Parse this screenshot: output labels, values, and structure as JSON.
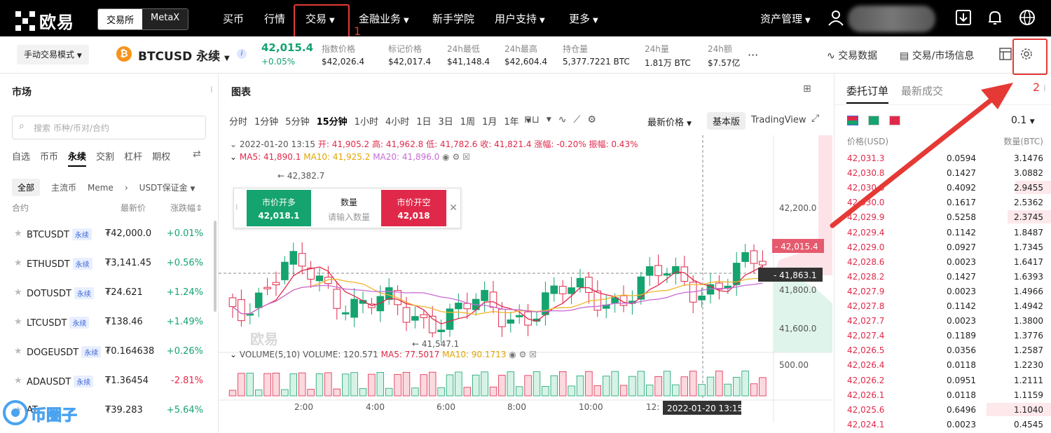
{
  "topbar": {
    "logo_text": "欧易",
    "segment": [
      "交易所",
      "MetaX"
    ],
    "nav": [
      {
        "label": "买币",
        "chev": false
      },
      {
        "label": "行情",
        "chev": false
      },
      {
        "label": "交易",
        "chev": true
      },
      {
        "label": "金融业务",
        "chev": true
      },
      {
        "label": "新手学院",
        "chev": false
      },
      {
        "label": "用户支持",
        "chev": true
      },
      {
        "label": "更多",
        "chev": true
      }
    ],
    "asset_mgmt": "资产管理",
    "annotation_1": "1",
    "icons": [
      "download-icon",
      "bell-icon",
      "globe-icon"
    ]
  },
  "ticker": {
    "mode": "手动交易模式",
    "symbol": "BTCUSD 永续",
    "coin": "₿",
    "last": "42,015.4",
    "change": "+0.05%",
    "stats": [
      {
        "k": "指数价格",
        "v": "$42,026.4"
      },
      {
        "k": "标记价格",
        "v": "$42,017.4"
      },
      {
        "k": "24h最低",
        "v": "$41,148.4"
      },
      {
        "k": "24h最高",
        "v": "$42,604.4"
      },
      {
        "k": "持仓量",
        "v": "5,377.7221 BTC"
      },
      {
        "k": "24h量",
        "v": "1.81万 BTC"
      },
      {
        "k": "24h额",
        "v": "$7.57亿"
      }
    ],
    "more": "···",
    "trade_data": "交易数据",
    "market_info": "交易/市场信息",
    "annotation_2": "2"
  },
  "market": {
    "title": "市场",
    "search_placeholder": "搜索 币种/币对/合约",
    "tabs": [
      "自选",
      "币币",
      "永续",
      "交割",
      "杠杆",
      "期权"
    ],
    "active_tab": "永续",
    "subtabs": [
      "全部",
      "主流币",
      "Meme",
      "USDT保证金"
    ],
    "col_contract": "合约",
    "col_price": "最新价",
    "col_change": "涨跌幅",
    "badge": "永续",
    "rows": [
      {
        "name": "BTCUSDT",
        "price": "₮42,000.0",
        "change": "+0.01%",
        "dir": "up"
      },
      {
        "name": "ETHUSDT",
        "price": "₮3,141.45",
        "change": "+0.56%",
        "dir": "up"
      },
      {
        "name": "DOTUSDT",
        "price": "₮24.621",
        "change": "+1.24%",
        "dir": "up"
      },
      {
        "name": "LTCUSDT",
        "price": "₮138.46",
        "change": "+1.49%",
        "dir": "up"
      },
      {
        "name": "DOGEUSDT",
        "price": "₮0.164638",
        "change": "+0.26%",
        "dir": "up"
      },
      {
        "name": "ADAUSDT",
        "price": "₮1.36454",
        "change": "-2.81%",
        "dir": "dn"
      },
      {
        "name": "AT",
        "price": "₮39.283",
        "change": "+5.64%",
        "dir": "up"
      }
    ],
    "watermark": "币圈子"
  },
  "chart": {
    "title": "图表",
    "intervals": [
      "分时",
      "1分钟",
      "5分钟",
      "15分钟",
      "1小时",
      "4小时",
      "1日",
      "3日",
      "1周",
      "1月",
      "1年"
    ],
    "active_interval": "15分钟",
    "price_type": "最新价格",
    "basic": "基本版",
    "tv": "TradingView",
    "ohlc": {
      "date": "2022-01-20 13:15",
      "open": "开: 41,905.2",
      "high": "高: 41,962.8",
      "low": "低: 41,782.6",
      "close": "收: 41,821.4",
      "chg": "涨幅: -0.20%",
      "amp": "振幅: 0.43%"
    },
    "ma": {
      "ma5": "MA5: 41,890.1",
      "ma10": "MA10: 41,925.2",
      "ma20": "MA20: 41,896.0"
    },
    "vol": {
      "label": "VOLUME(5,10)",
      "v": "VOLUME: 120.571",
      "ma5": "MA5: 77.5017",
      "ma10": "MA10: 90.1713"
    },
    "hi_label": "← 42,382.7",
    "lo_label": "← 41,547.1",
    "axis": [
      "42,200.0",
      "41,800.0",
      "41,600.0",
      "500.00"
    ],
    "last_tag": "- 42,015.4",
    "cross_tag": "- 41,863.1",
    "time_axis": [
      "2:00",
      "4:00",
      "6:00",
      "8:00",
      "10:00",
      "12:"
    ],
    "cross_time": "2022-01-20 13:15",
    "watermark": "欧易",
    "popup": {
      "buy": "市价开多",
      "buy_price": "42,018.1",
      "qty": "数量",
      "qty_ph": "请输入数量",
      "sell": "市价开空",
      "sell_price": "42,018"
    },
    "colors": {
      "up": "#15a36f",
      "down": "#e0294a",
      "ma5": "#e0294a",
      "ma10": "#f0b429",
      "ma20": "#c86ad4"
    }
  },
  "orderbook": {
    "tab1": "委托订单",
    "tab2": "最新成交",
    "step": "0.1",
    "col_price": "价格(USD)",
    "col_qty": "数量(BTC)",
    "rows": [
      {
        "p": "42,031.3",
        "q": "0.0594",
        "t": "3.1476",
        "d": 0.0
      },
      {
        "p": "42,030.8",
        "q": "0.1427",
        "t": "3.0882",
        "d": 0.0
      },
      {
        "p": "42,030.3",
        "q": "0.4092",
        "t": "2.9455",
        "d": 0.35
      },
      {
        "p": "42,030.0",
        "q": "0.1617",
        "t": "2.5362",
        "d": 0.0
      },
      {
        "p": "42,029.9",
        "q": "0.5258",
        "t": "2.3745",
        "d": 0.42
      },
      {
        "p": "42,029.4",
        "q": "0.1142",
        "t": "1.8487",
        "d": 0.0
      },
      {
        "p": "42,029.0",
        "q": "0.0927",
        "t": "1.7345",
        "d": 0.0
      },
      {
        "p": "42,028.6",
        "q": "0.0023",
        "t": "1.6417",
        "d": 0.0
      },
      {
        "p": "42,028.2",
        "q": "0.1427",
        "t": "1.6393",
        "d": 0.0
      },
      {
        "p": "42,027.9",
        "q": "0.0023",
        "t": "1.4966",
        "d": 0.0
      },
      {
        "p": "42,027.8",
        "q": "0.1142",
        "t": "1.4942",
        "d": 0.0
      },
      {
        "p": "42,027.7",
        "q": "0.0023",
        "t": "1.3800",
        "d": 0.0
      },
      {
        "p": "42,027.4",
        "q": "0.1189",
        "t": "1.3776",
        "d": 0.0
      },
      {
        "p": "42,026.5",
        "q": "0.0356",
        "t": "1.2587",
        "d": 0.0
      },
      {
        "p": "42,026.4",
        "q": "0.0118",
        "t": "1.2230",
        "d": 0.0
      },
      {
        "p": "42,026.2",
        "q": "0.0951",
        "t": "1.2111",
        "d": 0.0
      },
      {
        "p": "42,026.1",
        "q": "0.0118",
        "t": "1.1159",
        "d": 0.0
      },
      {
        "p": "42,025.6",
        "q": "0.6496",
        "t": "1.1040",
        "d": 0.62
      },
      {
        "p": "42,024.1",
        "q": "0.0023",
        "t": "0.4545",
        "d": 0.0
      }
    ]
  }
}
